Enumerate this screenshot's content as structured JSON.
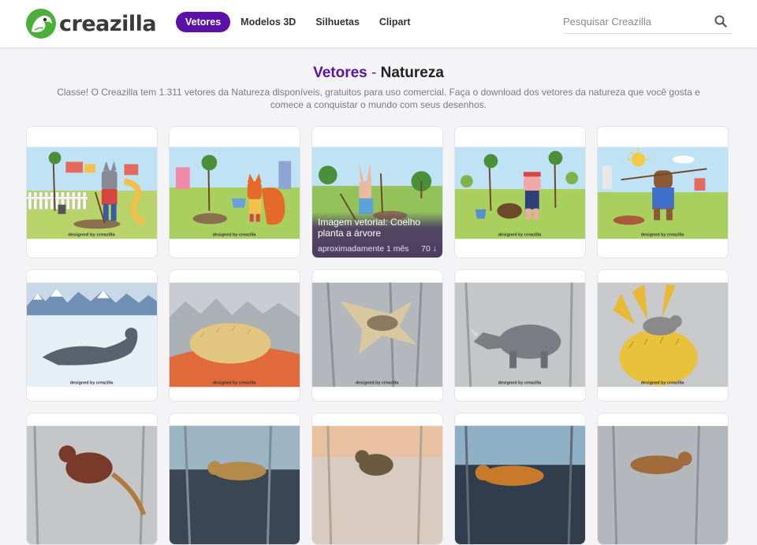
{
  "header": {
    "logo_text": "creazilla",
    "nav": [
      {
        "label": "Vetores",
        "active": true
      },
      {
        "label": "Modelos 3D",
        "active": false
      },
      {
        "label": "Silhuetas",
        "active": false
      },
      {
        "label": "Clipart",
        "active": false
      }
    ],
    "search_placeholder": "Pesquisar Creazilla",
    "accent_color": "#5b11a6"
  },
  "title": {
    "category": "Vetores",
    "separator": "-",
    "subject": "Natureza"
  },
  "description": "Classe! O Creazilla tem 1.311 vetores da Natureza disponíveis, gratuitos para uso comercial. Faça o download dos vetores da natureza que você gosta e comece a conquistar o mundo com seus desenhos.",
  "hover_card": {
    "title": "Imagem vetorial: Coelho planta a árvore",
    "age": "aproximadamente 1 mês",
    "downloads": "70"
  },
  "credit": "designed by creazilla",
  "cards": [
    {
      "subject": "wolf"
    },
    {
      "subject": "fox"
    },
    {
      "subject": "rabbit"
    },
    {
      "subject": "pig"
    },
    {
      "subject": "beaver"
    },
    {
      "subject": "seal"
    },
    {
      "subject": "echidna"
    },
    {
      "subject": "flying squirrel"
    },
    {
      "subject": "rhino"
    },
    {
      "subject": "mouse on flower"
    },
    {
      "subject": "tree kangaroo"
    },
    {
      "subject": "genet"
    },
    {
      "subject": "wildcat"
    },
    {
      "subject": "cougar"
    },
    {
      "subject": "cat"
    }
  ]
}
